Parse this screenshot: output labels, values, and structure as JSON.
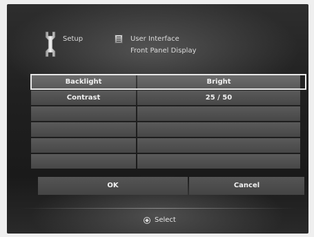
{
  "header": {
    "setup_label": "Setup",
    "section_label": "User Interface",
    "subsection_label": "Front Panel Display"
  },
  "settings": [
    {
      "name": "Backlight",
      "value": "Bright"
    },
    {
      "name": "Contrast",
      "value": "25 / 50"
    },
    {
      "name": "",
      "value": ""
    },
    {
      "name": "",
      "value": ""
    },
    {
      "name": "",
      "value": ""
    },
    {
      "name": "",
      "value": ""
    }
  ],
  "buttons": {
    "ok_label": "OK",
    "cancel_label": "Cancel"
  },
  "footer": {
    "select_label": "Select",
    "select_icon": "dpad-icon"
  }
}
